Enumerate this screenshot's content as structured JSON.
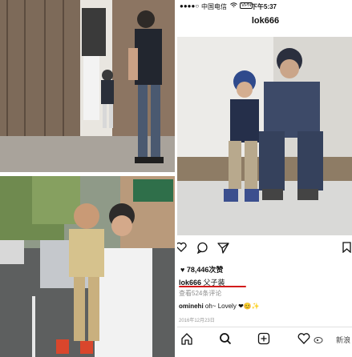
{
  "status_bar": {
    "carrier": "中国电信",
    "network": "VPN",
    "time": "下午5:37"
  },
  "profile": {
    "username": "lok666"
  },
  "post": {
    "likes_text": "78,446次赞",
    "caption_user": "lok666",
    "caption_text": "父子装",
    "view_comments": "查看524条评论",
    "comment_user": "ominehi",
    "comment_text": "oh~ Lovely",
    "comment_emojis": "❤😊✨",
    "date": "2016年12月23日"
  },
  "tabs": [
    {
      "name": "home",
      "icon": "home-icon"
    },
    {
      "name": "search",
      "icon": "search-icon"
    },
    {
      "name": "new-post",
      "icon": "plus-square-icon"
    },
    {
      "name": "activity",
      "icon": "heart-icon"
    },
    {
      "name": "profile",
      "icon": "profile-icon"
    }
  ],
  "watermark": "新浪",
  "colors": {
    "accent_underline": "#d21b1b",
    "heart": "#e0245e"
  }
}
